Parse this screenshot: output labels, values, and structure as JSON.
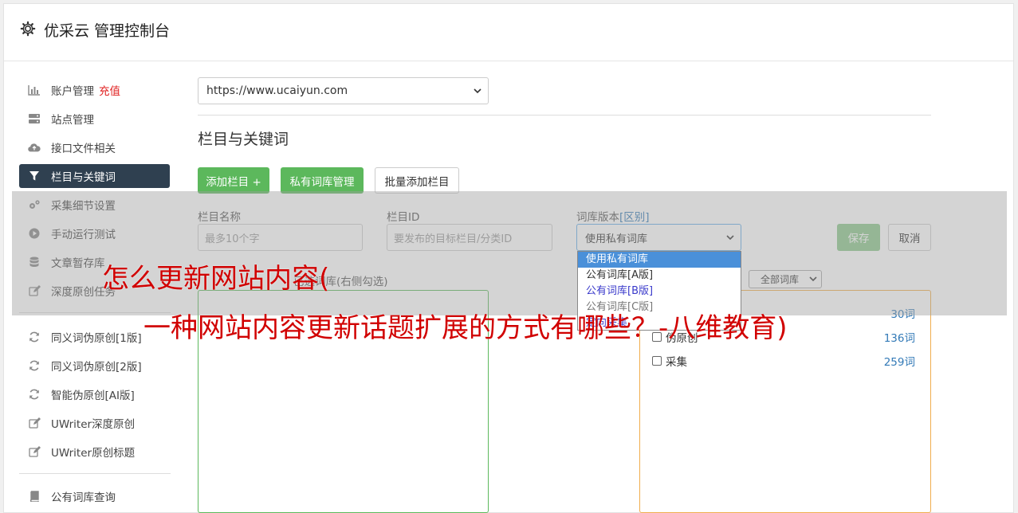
{
  "header": {
    "title": "优采云 管理控制台",
    "icon": "gear-icon"
  },
  "sidebar": {
    "items": [
      {
        "label": "账户管理",
        "badge": "充值",
        "icon": "bar-chart-icon"
      },
      {
        "label": "站点管理",
        "icon": "server-icon"
      },
      {
        "label": "接口文件相关",
        "icon": "cloud-upload-icon"
      },
      {
        "label": "栏目与关键词",
        "icon": "filter-icon",
        "active": true
      },
      {
        "label": "采集细节设置",
        "icon": "cogs-icon"
      },
      {
        "label": "手动运行测试",
        "icon": "play-circle-icon"
      },
      {
        "label": "文章暂存库",
        "icon": "database-icon"
      },
      {
        "label": "深度原创任务",
        "icon": "edit-icon"
      },
      {
        "label": "同义词伪原创[1版]",
        "icon": "refresh-icon"
      },
      {
        "label": "同义词伪原创[2版]",
        "icon": "refresh-icon"
      },
      {
        "label": "智能伪原创[AI版]",
        "icon": "refresh-icon"
      },
      {
        "label": "UWriter深度原创",
        "icon": "edit-icon"
      },
      {
        "label": "UWriter原创标题",
        "icon": "edit-icon"
      },
      {
        "label": "公有词库查询",
        "icon": "book-icon"
      }
    ]
  },
  "main": {
    "site_select_value": "https://www.ucaiyun.com",
    "section_title": "栏目与关键词",
    "buttons": {
      "add_column": "添加栏目 +",
      "private_lib": "私有词库管理",
      "batch_add": "批量添加栏目"
    },
    "form": {
      "column_name_label": "栏目名称",
      "column_name_placeholder": "最多10个字",
      "column_id_label": "栏目ID",
      "column_id_placeholder": "要发布的目标栏目/分类ID",
      "lib_version_label": "词库版本",
      "lib_version_link": "[区别]",
      "lib_version_value": "使用私有词库",
      "save": "保存",
      "cancel": "取消"
    },
    "dropdown_options": [
      "使用私有词库",
      "公有词库[A版]",
      "公有词库[B版]",
      "公有词库[C版]",
      "定向采集"
    ],
    "selected_keywords_label": "已选词库(右侧勾选)",
    "lib_filter_value": "全部词库",
    "libraries": [
      {
        "name": "",
        "count": "30词"
      },
      {
        "name": "伪原创",
        "count": "136词"
      },
      {
        "name": "采集",
        "count": "259词"
      }
    ]
  },
  "watermark": {
    "line1": "怎么更新网站内容(",
    "line2": "一种网站内容更新话题扩展的方式有哪些？-八维教育)"
  },
  "colors": {
    "sidebar_active": "#2f4050",
    "green": "#5cb85c",
    "accent_blue": "#337ab7",
    "watermark_red": "#d10000"
  }
}
